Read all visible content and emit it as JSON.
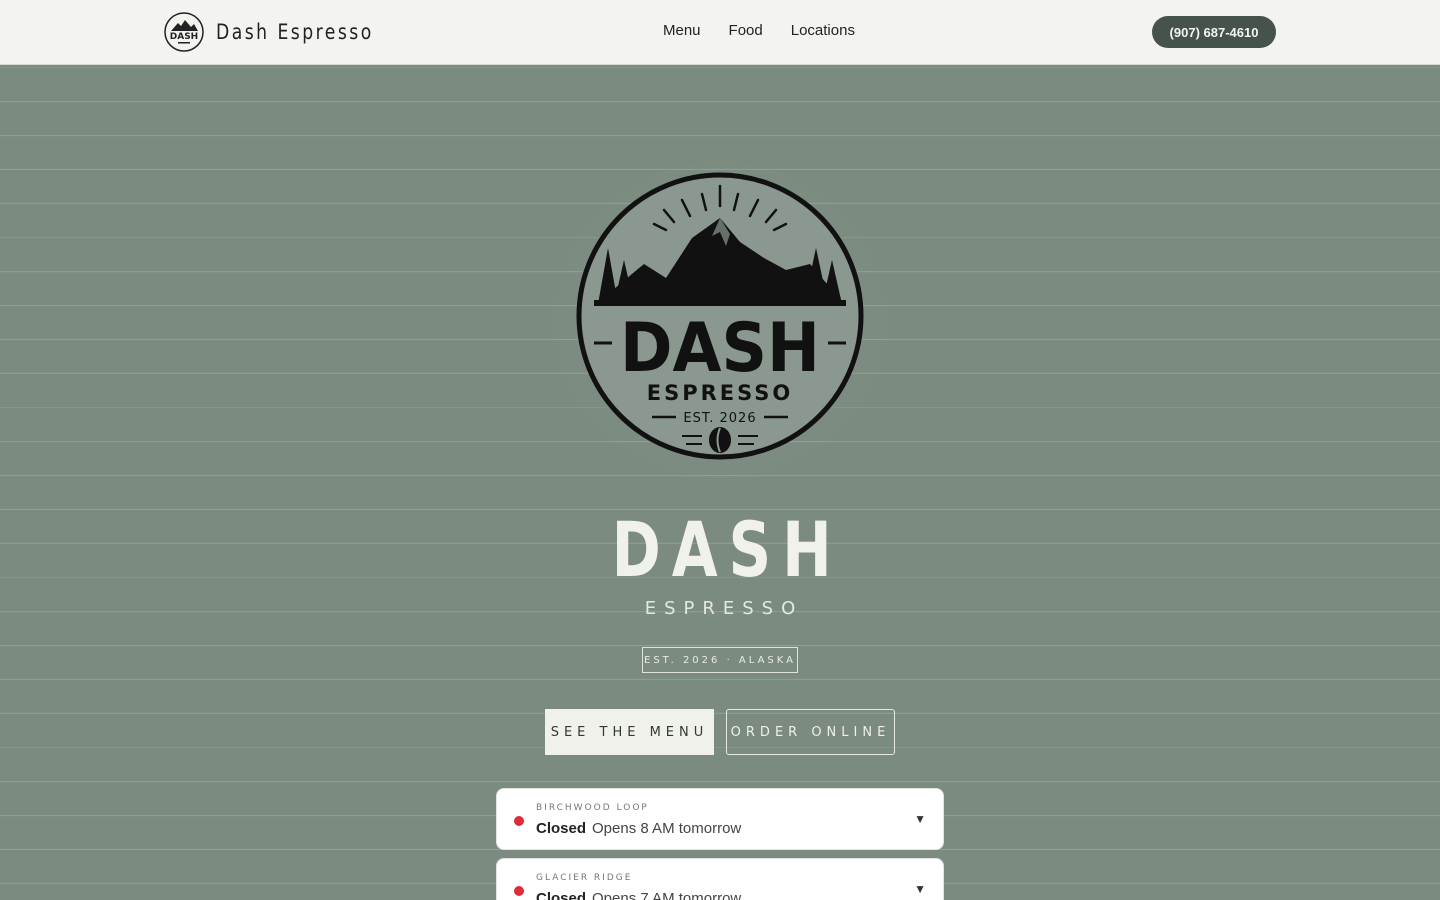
{
  "header": {
    "brand_name": "Dash Espresso",
    "nav": [
      "Menu",
      "Food",
      "Locations"
    ],
    "phone": "(907) 687-4610"
  },
  "logo": {
    "wordmark": "DASH",
    "subword": "ESPRESSO",
    "est": "EST. 2026"
  },
  "hero": {
    "title": "DASH",
    "subtitle": "ESPRESSO",
    "badge": "EST. 2026 · ALASKA",
    "primary_button": "SEE THE MENU",
    "secondary_button": "ORDER ONLINE"
  },
  "locations": [
    {
      "name": "BIRCHWOOD LOOP",
      "status": "Closed",
      "detail": "Opens 8 AM tomorrow"
    },
    {
      "name": "GLACIER RIDGE",
      "status": "Closed",
      "detail": "Opens 7 AM tomorrow"
    }
  ],
  "colors": {
    "background": "#7b8b80",
    "header": "#f3f3ef",
    "accent": "#46534b",
    "closed": "#e02b3a"
  },
  "icons": [
    "mountain-badge-logo",
    "coffee-bean-icon",
    "chevron-down-icon",
    "status-dot"
  ]
}
